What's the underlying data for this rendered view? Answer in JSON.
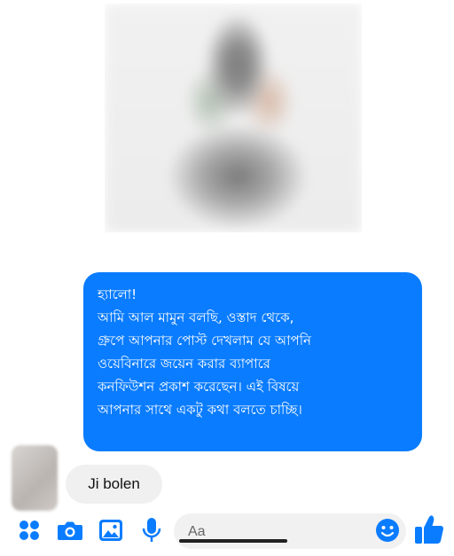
{
  "chat": {
    "outgoing_message": {
      "lines": [
        "হ্যালো!",
        "আমি আল মামুন বলছি, ওস্তাদ থেকে,",
        "গ্রুপে আপনার পোস্ট দেখলাম যে আপনি",
        "ওয়েবিনারে জয়েন করার ব্যাপারে",
        "কনফিউশন প্রকাশ করেছেন। এই বিষয়ে",
        "আপনার সাথে একটু কথা বলতে চাচ্ছি।"
      ]
    },
    "incoming_message": {
      "text": "Ji bolen"
    }
  },
  "composer": {
    "placeholder": "Aa",
    "icons": [
      "apps-icon",
      "camera-icon",
      "image-icon",
      "microphone-icon",
      "emoji-icon",
      "thumbs-up-icon"
    ]
  },
  "colors": {
    "accent": "#0a7cff",
    "outgoing_bubble": "#0a7cff",
    "incoming_bubble": "#f0f0f0",
    "composer_pill": "#f1f1f1"
  }
}
